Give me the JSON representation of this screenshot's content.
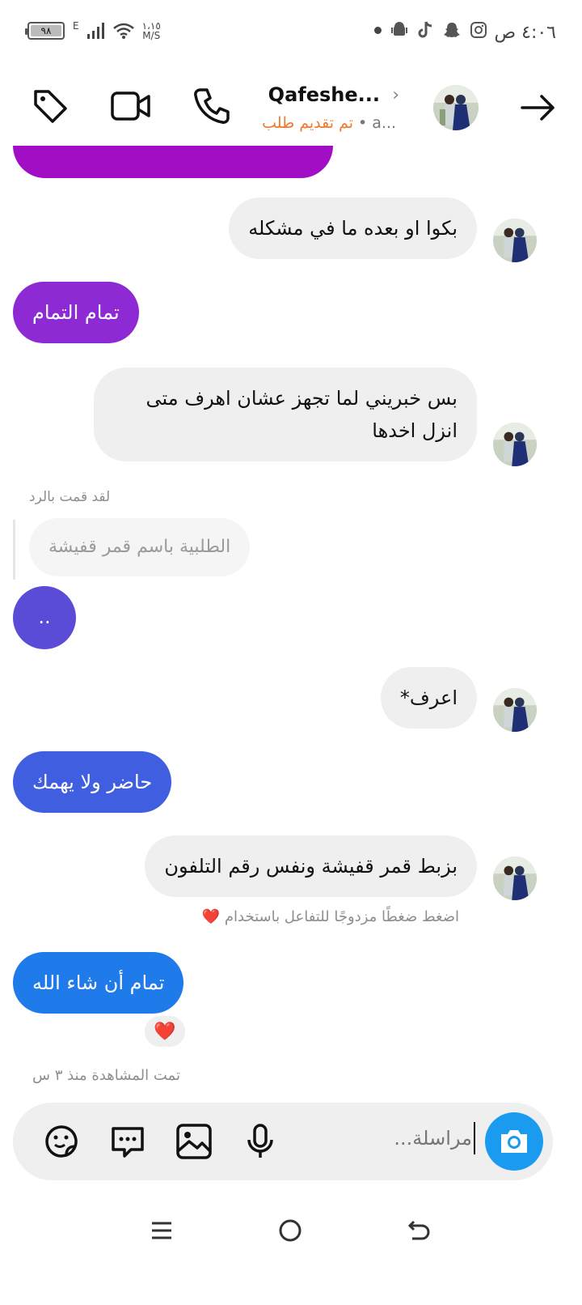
{
  "status_bar": {
    "time": "٤:٠٦ ص",
    "battery": "٩٨",
    "network_type": "E",
    "net_speed": "١،١٥",
    "net_unit": "M/S"
  },
  "header": {
    "name": "Qafeshe...",
    "status_request": "تم تقديم طلب",
    "status_sep": "•",
    "status_extra": "a..."
  },
  "messages": [
    {
      "id": "m1",
      "side": "in",
      "text": "بكوا او بعده ما في مشكله"
    },
    {
      "id": "m2",
      "side": "out",
      "text": "تمام التمام",
      "color": "#8d2ad4"
    },
    {
      "id": "m3",
      "side": "in",
      "line1": "بس خبريني لما تجهز عشان اهرف متى",
      "line2": "انزل اخدها"
    },
    {
      "id": "m4",
      "side": "out",
      "reply_label": "لقد قمت بالرد",
      "quoted_text": "الطلبية باسم قمر قفيشة",
      "text": "..",
      "color": "#5b4cd8"
    },
    {
      "id": "m5",
      "side": "in",
      "text": "اعرف*"
    },
    {
      "id": "m6",
      "side": "out",
      "text": "حاضر ولا يهمك",
      "color": "#3f5ee0"
    },
    {
      "id": "m7",
      "side": "in",
      "text": "بزبط قمر قفيشة ونفس رقم التلفون",
      "hint": "اضغط ضغطًا مزدوجًا للتفاعل باستخدام"
    },
    {
      "id": "m8",
      "side": "out",
      "text": "تمام أن شاء الله",
      "color": "#1f7be9",
      "reaction": "❤️"
    }
  ],
  "seen_label": "تمت المشاهدة منذ ٣ س",
  "composer": {
    "placeholder": "مراسلة..."
  },
  "colors": {
    "accent_orange": "#f2792d",
    "camera_blue": "#1b9bf0",
    "incoming_bg": "#efefef"
  }
}
